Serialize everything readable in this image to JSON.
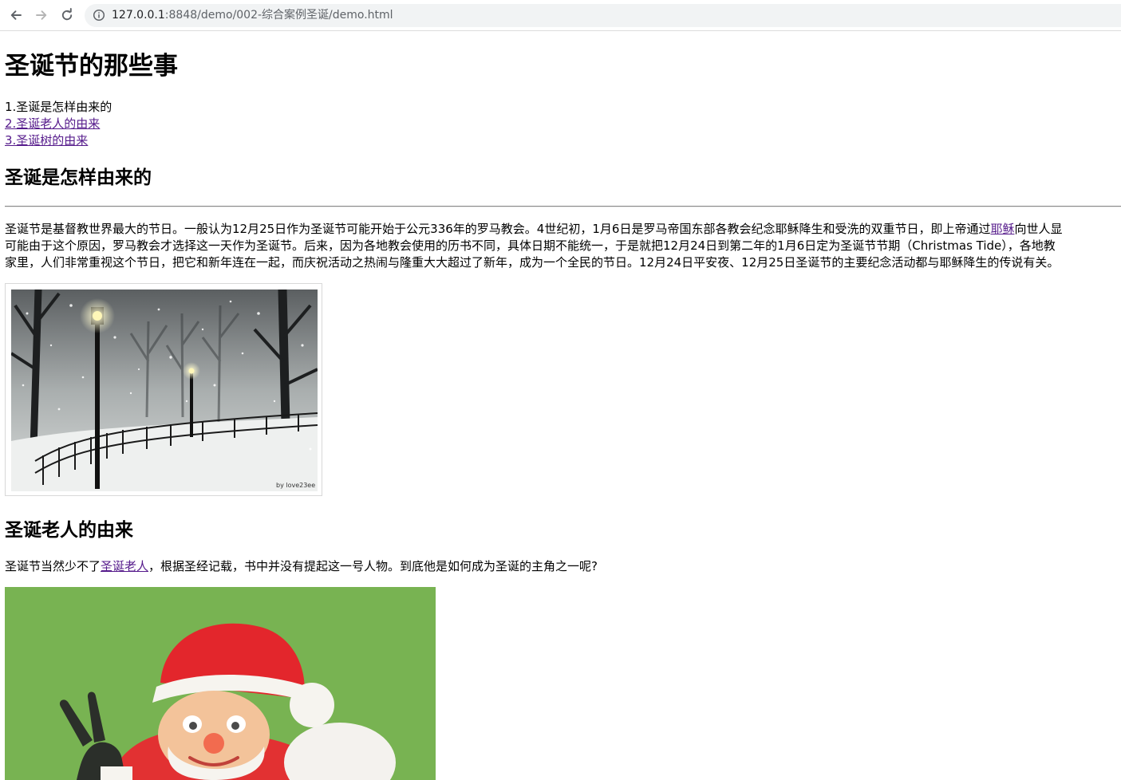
{
  "browser": {
    "url_host": "127.0.0.1",
    "url_rest": ":8848/demo/002-综合案例圣诞/demo.html"
  },
  "page": {
    "title": "圣诞节的那些事",
    "toc": [
      "1.圣诞是怎样由来的",
      "2.圣诞老人的由来",
      "3.圣诞树的由来"
    ],
    "section1": {
      "heading": "圣诞是怎样由来的",
      "line1_before": "圣诞节是基督教世界最大的节日。一般认为12月25日作为圣诞节可能开始于公元336年的罗马教会。4世纪初，1月6日是罗马帝国东部各教会纪念耶稣降生和受洗的双重节日，即上帝通过",
      "line1_link": "耶稣",
      "line1_after": "向世人显",
      "line2": "可能由于这个原因，罗马教会才选择这一天作为圣诞节。后来，因为各地教会使用的历书不同，具体日期不能统一，于是就把12月24日到第二年的1月6日定为圣诞节节期（Christmas Tide），各地教",
      "line3": "家里，人们非常重视这个节日，把它和新年连在一起，而庆祝活动之热闹与隆重大大超过了新年，成为一个全民的节日。12月24日平安夜、12月25日圣诞节的主要纪念活动都与耶稣降生的传说有关。",
      "image_credit": "by love23ee"
    },
    "section2": {
      "heading": "圣诞老人的由来",
      "para_before": "圣诞节当然少不了",
      "para_link": "圣诞老人",
      "para_after": "，根据圣经记载，书中并没有提起这一号人物。到底他是如何成为圣诞的主角之一呢?"
    }
  }
}
